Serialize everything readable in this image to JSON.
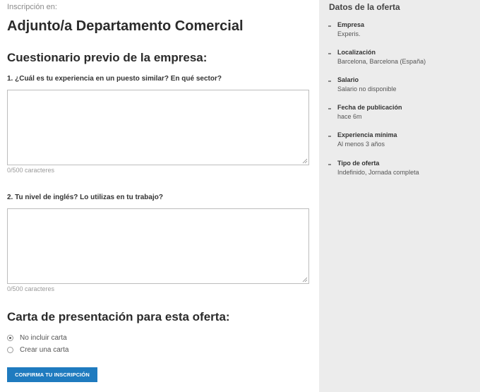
{
  "application": {
    "inscripcion_label": "Inscripción en:",
    "job_title": "Adjunto/a Departamento Comercial"
  },
  "questionnaire": {
    "title": "Cuestionario previo de la empresa:",
    "questions": [
      {
        "text": "1. ¿Cuál es tu experiencia en un puesto similar? En qué sector?",
        "value": "",
        "counter": "0/500 caracteres"
      },
      {
        "text": "2. Tu nivel de inglés? Lo utilizas en tu trabajo?",
        "value": "",
        "counter": "0/500 caracteres"
      }
    ]
  },
  "cover_letter": {
    "title": "Carta de presentación para esta oferta:",
    "options": [
      {
        "label": "No incluir carta",
        "selected": true
      },
      {
        "label": "Crear una carta",
        "selected": false
      }
    ]
  },
  "confirm_button": {
    "label": "CONFIRMA TU INSCRIPCIÓN",
    "color": "#1f7bbf"
  },
  "offer": {
    "title": "Datos de la oferta",
    "items": [
      {
        "label": "Empresa",
        "value": "Experis."
      },
      {
        "label": "Localización",
        "value": "Barcelona, Barcelona (España)"
      },
      {
        "label": "Salario",
        "value": "Salario no disponible"
      },
      {
        "label": "Fecha de publicación",
        "value": "hace 6m"
      },
      {
        "label": "Experiencia mínima",
        "value": "Al menos 3 años"
      },
      {
        "label": "Tipo de oferta",
        "value": "Indefinido, Jornada completa"
      }
    ]
  },
  "icons": {
    "radio_selected": "radio-selected-icon",
    "radio_unselected": "radio-unselected-icon",
    "bullet": "bullet-icon",
    "resize": "resize-grip-icon"
  }
}
